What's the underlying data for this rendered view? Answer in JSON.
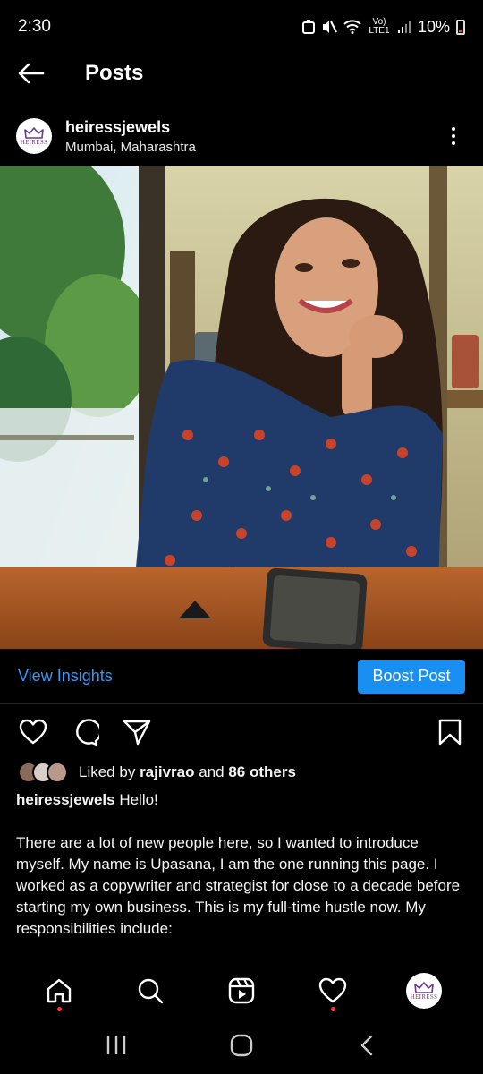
{
  "status_bar": {
    "time": "2:30",
    "network": "Vo) LTE1",
    "battery": "10%"
  },
  "top_bar": {
    "title": "Posts"
  },
  "post": {
    "avatar_text": "HEIRESS",
    "username": "heiressjewels",
    "location": "Mumbai, Maharashtra",
    "insights_label": "View Insights",
    "boost_label": "Boost Post",
    "likes": {
      "prefix": "Liked by",
      "user": "rajivrao",
      "connector": "and",
      "others": "86 others"
    },
    "caption": {
      "username": "heiressjewels",
      "first_line": "Hello!",
      "body": "There are a lot of new people here, so I wanted to introduce myself. My name is Upasana, I am the one running this page. I worked as a copywriter and strategist for close to a decade before starting my own business. This is my full-time hustle now. My responsibilities include:"
    }
  },
  "colors": {
    "accent": "#3897f0",
    "boost": "#1a8ff2",
    "notification": "#ff3040"
  },
  "icons": [
    "back-arrow-icon",
    "more-options-icon",
    "heart-icon",
    "comment-icon",
    "share-icon",
    "bookmark-icon",
    "home-icon",
    "search-icon",
    "reels-icon",
    "activity-icon",
    "recents-icon",
    "home-circle-icon",
    "back-chevron-icon"
  ]
}
